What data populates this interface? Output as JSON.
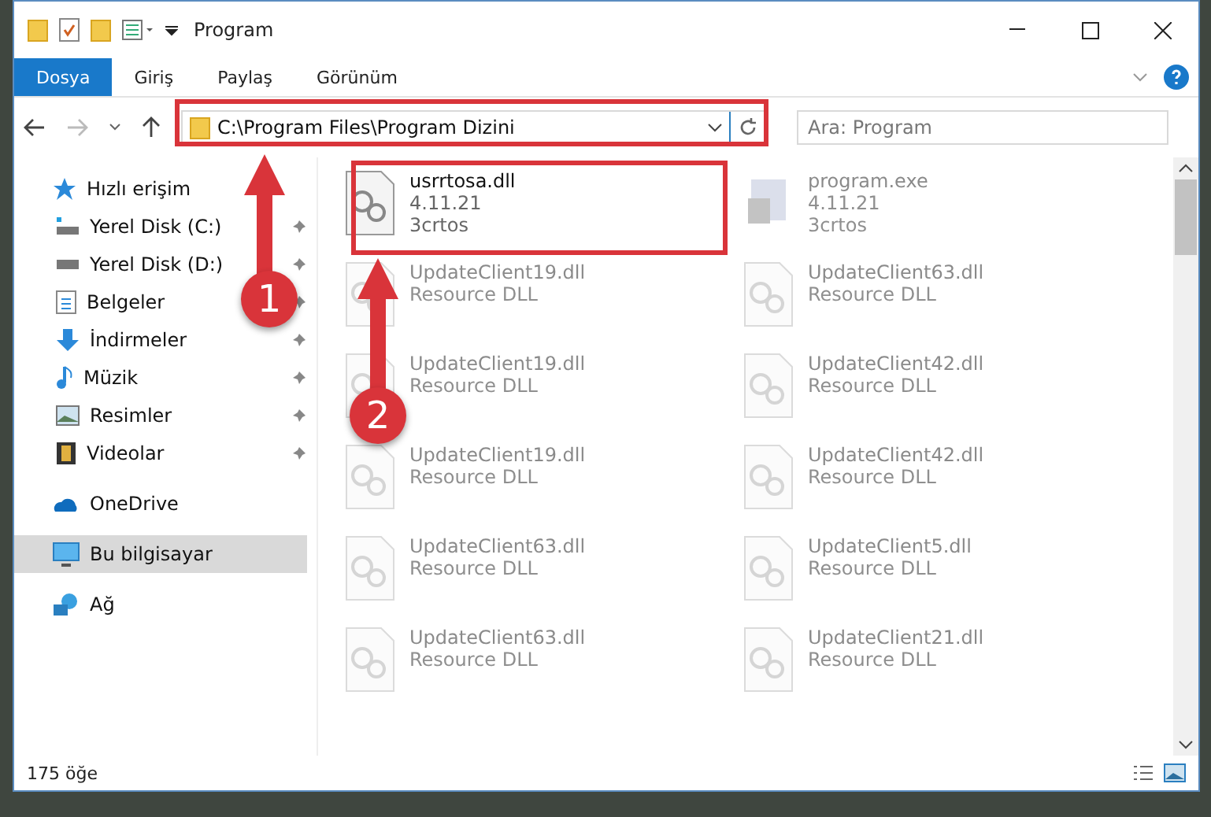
{
  "window": {
    "title": "Program"
  },
  "ribbon": {
    "tabs": [
      {
        "label": "Dosya",
        "selected": true
      },
      {
        "label": "Giriş",
        "selected": false
      },
      {
        "label": "Paylaş",
        "selected": false
      },
      {
        "label": "Görünüm",
        "selected": false
      }
    ]
  },
  "address": {
    "path": "C:\\Program Files\\Program Dizini",
    "search_placeholder": "Ara: Program"
  },
  "sidebar": {
    "items": [
      {
        "kind": "quick",
        "label": "Hızlı erişim",
        "pinned": false,
        "selected": false,
        "children": [
          {
            "kind": "drive-c",
            "label": "Yerel Disk (C:)",
            "pinned": true,
            "selected": false
          },
          {
            "kind": "drive",
            "label": "Yerel Disk (D:)",
            "pinned": true,
            "selected": false
          },
          {
            "kind": "documents",
            "label": "Belgeler",
            "pinned": true,
            "selected": false
          },
          {
            "kind": "downloads",
            "label": "İndirmeler",
            "pinned": true,
            "selected": false
          },
          {
            "kind": "music",
            "label": "Müzik",
            "pinned": true,
            "selected": false
          },
          {
            "kind": "pictures",
            "label": "Resimler",
            "pinned": true,
            "selected": false
          },
          {
            "kind": "videos",
            "label": "Videolar",
            "pinned": true,
            "selected": false
          }
        ]
      },
      {
        "kind": "onedrive",
        "label": "OneDrive",
        "pinned": false,
        "selected": false
      },
      {
        "kind": "pc",
        "label": "Bu bilgisayar",
        "pinned": false,
        "selected": true
      },
      {
        "kind": "network",
        "label": "Ağ",
        "pinned": false,
        "selected": false
      }
    ]
  },
  "files": [
    {
      "kind": "dll",
      "name": "usrrtosa.dll",
      "lines": [
        "4.11.21",
        "3crtos"
      ],
      "blurred": false
    },
    {
      "kind": "exe",
      "name": "program.exe",
      "lines": [
        "4.11.21",
        "3crtos"
      ],
      "blurred": true
    },
    {
      "kind": "dll",
      "name": "UpdateClient19.dll",
      "lines": [
        "Resource DLL"
      ],
      "blurred": true
    },
    {
      "kind": "dll",
      "name": "UpdateClient63.dll",
      "lines": [
        "Resource DLL"
      ],
      "blurred": true
    },
    {
      "kind": "dll",
      "name": "UpdateClient19.dll",
      "lines": [
        "Resource DLL"
      ],
      "blurred": true
    },
    {
      "kind": "dll",
      "name": "UpdateClient42.dll",
      "lines": [
        "Resource DLL"
      ],
      "blurred": true
    },
    {
      "kind": "dll",
      "name": "UpdateClient19.dll",
      "lines": [
        "Resource DLL"
      ],
      "blurred": true
    },
    {
      "kind": "dll",
      "name": "UpdateClient42.dll",
      "lines": [
        "Resource DLL"
      ],
      "blurred": true
    },
    {
      "kind": "dll",
      "name": "UpdateClient63.dll",
      "lines": [
        "Resource DLL"
      ],
      "blurred": true
    },
    {
      "kind": "dll",
      "name": "UpdateClient5.dll",
      "lines": [
        "Resource DLL"
      ],
      "blurred": true
    },
    {
      "kind": "dll",
      "name": "UpdateClient63.dll",
      "lines": [
        "Resource DLL"
      ],
      "blurred": true
    },
    {
      "kind": "dll",
      "name": "UpdateClient21.dll",
      "lines": [
        "Resource DLL"
      ],
      "blurred": true
    }
  ],
  "status_bar": {
    "count": "175 öğe"
  },
  "annotations": [
    {
      "label": "1"
    },
    {
      "label": "2"
    }
  ]
}
